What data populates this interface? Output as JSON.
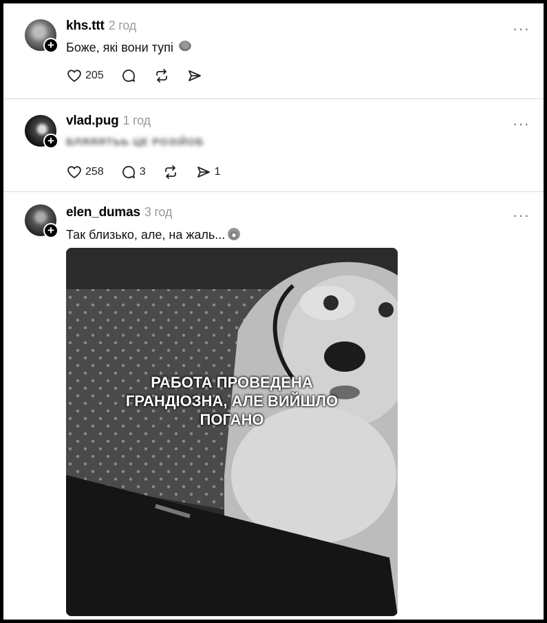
{
  "posts": [
    {
      "username": "khs.ttt",
      "time": "2 год",
      "text": "Боже, які вони тупі",
      "likes": "205",
      "replies": "",
      "shares": ""
    },
    {
      "username": "vlad.pug",
      "time": "1 год",
      "text": "БЛЯЯЯТЬЬ ЦЕ РОЗІЙОБ",
      "likes": "258",
      "replies": "3",
      "shares": "1"
    },
    {
      "username": "elen_dumas",
      "time": "3 год",
      "text": "Так близько, але, на жаль...",
      "meme_caption_lines": [
        "РАБОТА ПРОВЕДЕНА",
        "ГРАНДІОЗНА, АЛЕ ВИЙШЛО",
        "ПОГАНО"
      ]
    }
  ],
  "icons": {
    "more": "more-options-icon",
    "like": "heart-icon",
    "reply": "comment-icon",
    "repost": "repost-icon",
    "share": "share-icon",
    "follow": "plus-icon"
  },
  "more_label": "···"
}
